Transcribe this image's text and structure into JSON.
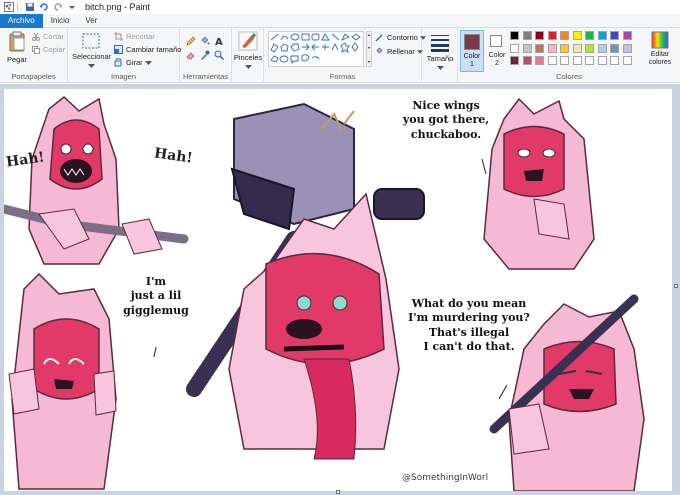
{
  "window": {
    "title": "bitch.png - Paint"
  },
  "tabs": [
    {
      "label": "Archivo",
      "active": true
    },
    {
      "label": "Inicio",
      "active": false
    },
    {
      "label": "Ver",
      "active": false
    }
  ],
  "ribbon": {
    "clipboard": {
      "label": "Portapapeles",
      "paste": "Pegar",
      "cut": "Cortar",
      "copy": "Copiar"
    },
    "image": {
      "label": "Imagen",
      "select": "Seleccionar",
      "crop": "Recortar",
      "resize": "Cambiar tamaño",
      "rotate": "Girar"
    },
    "tools": {
      "label": "Herramientas"
    },
    "brushes": {
      "label": "Pinceles"
    },
    "shapes": {
      "label": "Formas",
      "outline": "Contorno",
      "fill": "Rellenar"
    },
    "size": {
      "label": "Tamaño"
    },
    "colors": {
      "label": "Colores",
      "color1": "Color",
      "color1_num": "1",
      "color2": "Color",
      "color2_num": "2",
      "edit": "Editar",
      "edit2": "colores",
      "color1_value": "#7b3a4a",
      "color2_value": "#ffffff",
      "palette_row1": [
        "#000000",
        "#7f7f7f",
        "#880015",
        "#ed1c24",
        "#ff7f27",
        "#fff200",
        "#22b14c",
        "#00a2e8",
        "#3f48cc",
        "#a349a4"
      ],
      "palette_row2": [
        "#ffffff",
        "#c3c3c3",
        "#b97a57",
        "#ffaec9",
        "#ffc90e",
        "#efe4b0",
        "#b5e61d",
        "#99d9ea",
        "#7092be",
        "#c8bfe7"
      ],
      "palette_row3": [
        "#7b1f3a",
        "#c04a6b",
        "#e07a95",
        "#ffffff",
        "#ffffff",
        "#ffffff",
        "#ffffff",
        "#ffffff",
        "#ffffff",
        "#ffffff"
      ]
    }
  },
  "artwork": {
    "laugh_left": "Hah!",
    "laugh_right": "Hah!",
    "speech1": [
      "Nice wings",
      "you got there,",
      "chuckaboo."
    ],
    "speech2": [
      "I'm",
      "just a lil",
      "gigglemug"
    ],
    "speech3": [
      "What do you mean",
      "I'm murdering you?",
      "That's illegal",
      "I can't do that."
    ],
    "credit": "@SomethingInWorl"
  }
}
